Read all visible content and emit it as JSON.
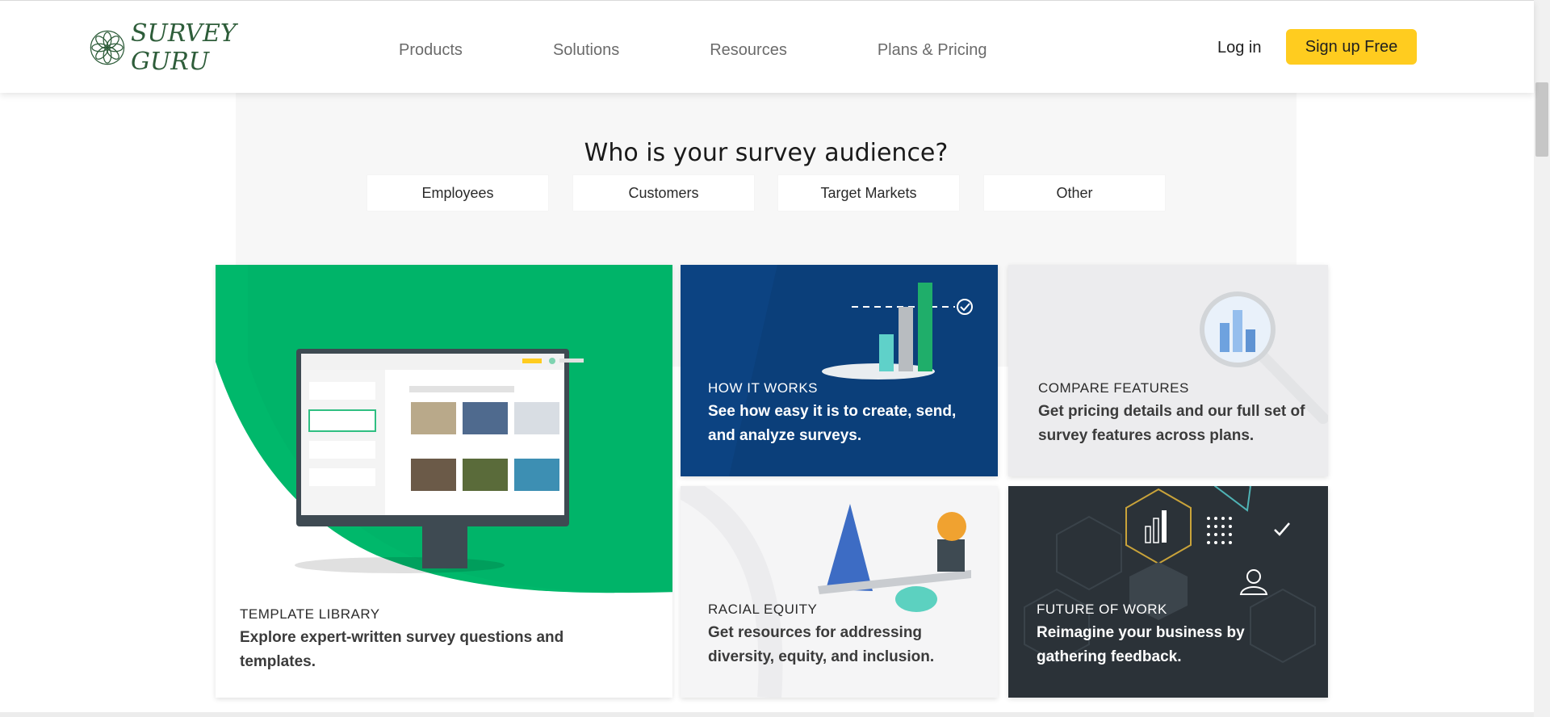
{
  "header": {
    "logo_text": "SURVEY GURU",
    "nav": [
      "Products",
      "Solutions",
      "Resources",
      "Plans & Pricing"
    ],
    "login_label": "Log in",
    "signup_label": "Sign up Free"
  },
  "audience": {
    "title": "Who is your survey audience?",
    "options": [
      "Employees",
      "Customers",
      "Target Markets",
      "Other"
    ]
  },
  "cards": {
    "template": {
      "kicker": "TEMPLATE LIBRARY",
      "desc": "Explore expert-written survey questions and templates."
    },
    "how": {
      "kicker": "HOW IT WORKS",
      "desc": "See how easy it is to create, send, and analyze surveys."
    },
    "compare": {
      "kicker": "COMPARE FEATURES",
      "desc": "Get pricing details and our full set of survey features across plans."
    },
    "racial": {
      "kicker": "RACIAL EQUITY",
      "desc": "Get resources for addressing diversity, equity, and inclusion."
    },
    "future": {
      "kicker": "FUTURE OF WORK",
      "desc": "Reimagine your business by gathering feedback."
    }
  },
  "colors": {
    "brand_green": "#00b86b",
    "accent_yellow": "#ffcc1f",
    "navy": "#0b3f7a",
    "charcoal": "#2b3238"
  },
  "icons": [
    "flower-logo-icon",
    "bar-chart-icon",
    "magnifier-icon",
    "checkmark-icon",
    "person-icon",
    "dots-grid-icon"
  ]
}
